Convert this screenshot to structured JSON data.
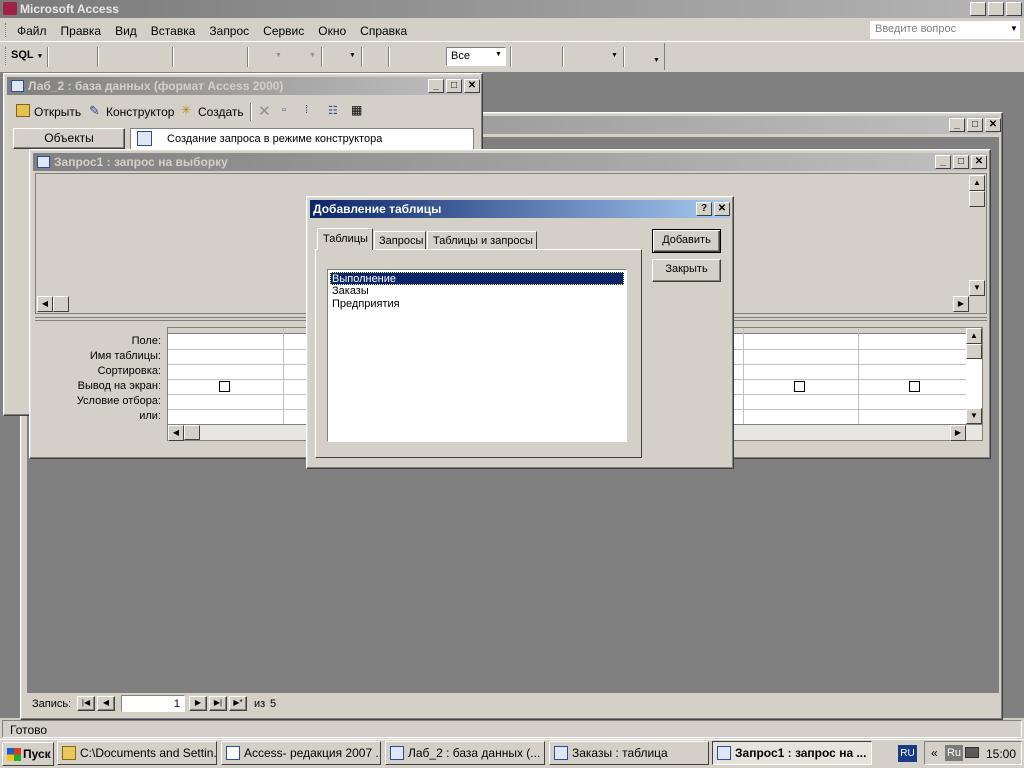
{
  "app": {
    "title": "Microsoft Access",
    "menu": [
      "Файл",
      "Правка",
      "Вид",
      "Вставка",
      "Запрос",
      "Сервис",
      "Окно",
      "Справка"
    ],
    "help_placeholder": "Введите вопрос",
    "toolbar": {
      "sql_label": "SQL",
      "sigma": "Σ",
      "top_values": "Все"
    }
  },
  "db_window": {
    "title": "Лаб_2 : база данных (формат Access 2000)",
    "buttons": {
      "open": "Открыть",
      "design": "Конструктор",
      "create": "Создать"
    },
    "objects_label": "Объекты",
    "item": "Создание запроса в режиме конструктора"
  },
  "query_window": {
    "title": "Запрос1 : запрос на выборку",
    "row_labels": [
      "Поле:",
      "Имя таблицы:",
      "Сортировка:",
      "Вывод на экран:",
      "Условие отбора:",
      "или:"
    ]
  },
  "dialog": {
    "title": "Добавление таблицы",
    "help": "?",
    "tabs": [
      "Таблицы",
      "Запросы",
      "Таблицы и запросы"
    ],
    "tables": [
      "Выполнение",
      "Заказы",
      "Предприятия"
    ],
    "selected_index": 0,
    "add_button": "Добавить",
    "close_button": "Закрыть"
  },
  "record_nav": {
    "label": "Запись:",
    "current": "1",
    "of_label": "из",
    "total": "5"
  },
  "status_text": "Готово",
  "taskbar": {
    "start": "Пуск",
    "items": [
      "C:\\Documents and Settin...",
      "Access- редакция 2007 ...",
      "Лаб_2 : база данных (...",
      "Заказы : таблица",
      "Запрос1 : запрос на ..."
    ],
    "lang": "RU",
    "tray_lang": "Ru",
    "clock": "15:00"
  }
}
